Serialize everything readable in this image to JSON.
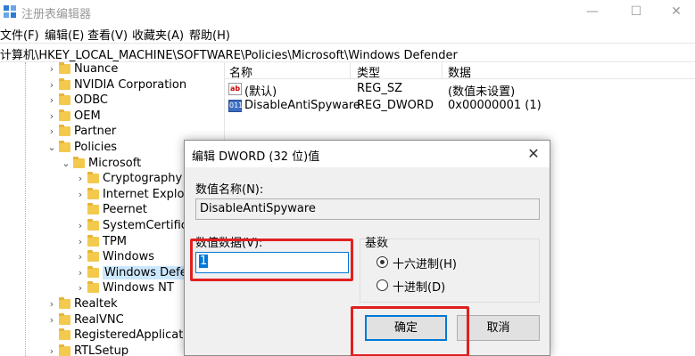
{
  "window": {
    "title": "注册表编辑器",
    "minimize_glyph": "—",
    "maximize_glyph": "☐",
    "close_glyph": "✕"
  },
  "menu": [
    "文件(F)",
    "编辑(E)",
    "查看(V)",
    "收藏夹(A)",
    "帮助(H)"
  ],
  "address": "计算机\\HKEY_LOCAL_MACHINE\\SOFTWARE\\Policies\\Microsoft\\Windows Defender",
  "tree": [
    {
      "label": "Nuance",
      "level": 0,
      "state": "collapsed"
    },
    {
      "label": "NVIDIA Corporation",
      "level": 0,
      "state": "collapsed"
    },
    {
      "label": "ODBC",
      "level": 0,
      "state": "collapsed"
    },
    {
      "label": "OEM",
      "level": 0,
      "state": "collapsed"
    },
    {
      "label": "Partner",
      "level": 0,
      "state": "collapsed"
    },
    {
      "label": "Policies",
      "level": 0,
      "state": "expanded"
    },
    {
      "label": "Microsoft",
      "level": 1,
      "state": "expanded"
    },
    {
      "label": "Cryptography",
      "level": 2,
      "state": "collapsed"
    },
    {
      "label": "Internet Explore",
      "level": 2,
      "state": "collapsed"
    },
    {
      "label": "Peernet",
      "level": 2,
      "state": "leaf"
    },
    {
      "label": "SystemCertifica",
      "level": 2,
      "state": "collapsed"
    },
    {
      "label": "TPM",
      "level": 2,
      "state": "collapsed"
    },
    {
      "label": "Windows",
      "level": 2,
      "state": "collapsed"
    },
    {
      "label": "Windows Defer",
      "level": 2,
      "state": "collapsed",
      "selected": true
    },
    {
      "label": "Windows NT",
      "level": 2,
      "state": "collapsed"
    },
    {
      "label": "Realtek",
      "level": 0,
      "state": "collapsed"
    },
    {
      "label": "RealVNC",
      "level": 0,
      "state": "collapsed"
    },
    {
      "label": "RegisteredApplicatio",
      "level": 0,
      "state": "leaf"
    },
    {
      "label": "RTLSetup",
      "level": 0,
      "state": "collapsed"
    }
  ],
  "list": {
    "columns": [
      "名称",
      "类型",
      "数据"
    ],
    "rows": [
      {
        "icon": "string-value-icon",
        "icon_text": "ab",
        "name": "(默认)",
        "type": "REG_SZ",
        "data": "(数值未设置)"
      },
      {
        "icon": "dword-value-icon",
        "icon_text": "011",
        "name": "DisableAntiSpyware",
        "type": "REG_DWORD",
        "data": "0x00000001 (1)"
      }
    ]
  },
  "dialog": {
    "title": "编辑 DWORD (32 位)值",
    "close_glyph": "✕",
    "name_label": "数值名称(N):",
    "name_value": "DisableAntiSpyware",
    "data_label": "数值数据(V):",
    "data_value": "1",
    "base_label": "基数",
    "radios": [
      {
        "label": "十六进制(H)",
        "checked": true
      },
      {
        "label": "十进制(D)",
        "checked": false
      }
    ],
    "ok_label": "确定",
    "cancel_label": "取消"
  },
  "colors": {
    "annotation": "#e02020",
    "selection": "#cce8ff",
    "focus": "#0078d7"
  }
}
